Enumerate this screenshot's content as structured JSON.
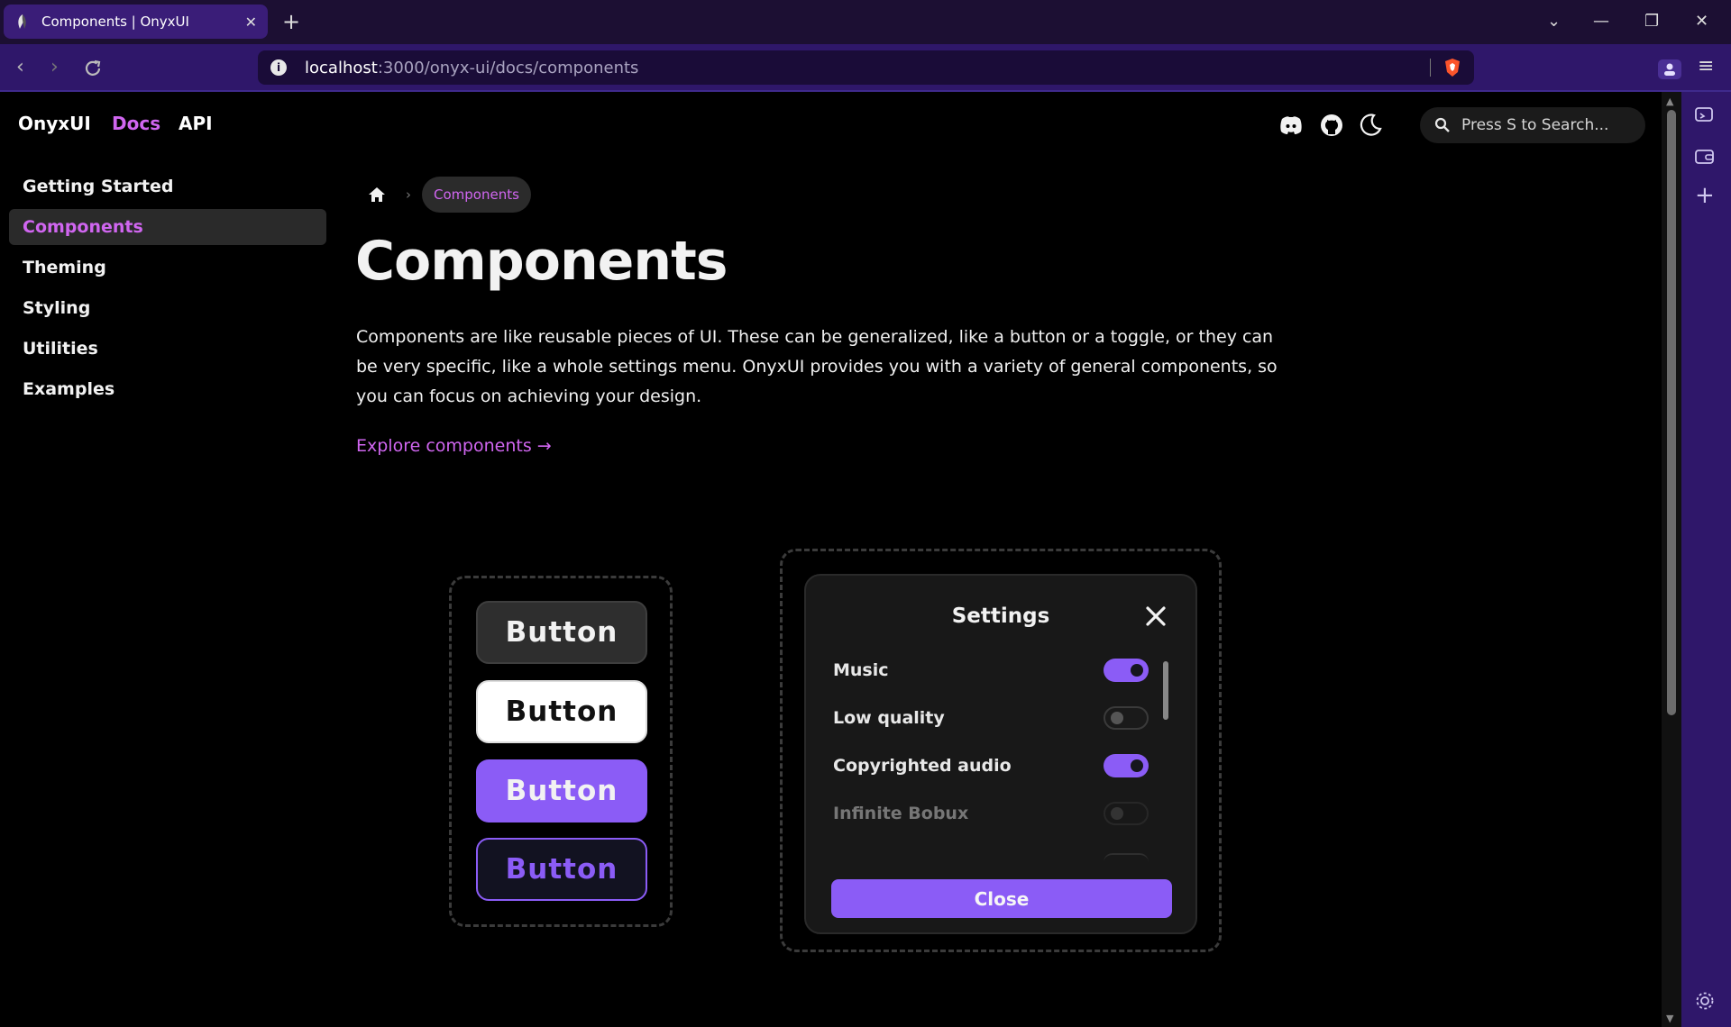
{
  "browser": {
    "tab_title": "Components | OnyxUI",
    "url_host": "localhost",
    "url_path": ":3000/onyx-ui/docs/components"
  },
  "site": {
    "brand": "OnyxUI",
    "nav": [
      {
        "label": "Docs",
        "active": true
      },
      {
        "label": "API",
        "active": false
      }
    ],
    "search_placeholder": "Press S to Search...",
    "accent_color": "#d066f0",
    "primary_color": "#8b5cf6"
  },
  "sidebar": {
    "items": [
      {
        "label": "Getting Started",
        "active": false
      },
      {
        "label": "Components",
        "active": true
      },
      {
        "label": "Theming",
        "active": false
      },
      {
        "label": "Styling",
        "active": false
      },
      {
        "label": "Utilities",
        "active": false
      },
      {
        "label": "Examples",
        "active": false
      }
    ]
  },
  "main": {
    "breadcrumb": "Components",
    "title": "Components",
    "intro": "Components are like reusable pieces of UI. These can be generalized, like a button or a toggle, or they can be very specific, like a whole settings menu. OnyxUI provides you with a variety of general components, so you can focus on achieving your design.",
    "explore_link": "Explore components →"
  },
  "showcase": {
    "buttons": [
      "Button",
      "Button",
      "Button",
      "Button"
    ],
    "settings": {
      "title": "Settings",
      "options": [
        {
          "label": "Music",
          "on": true
        },
        {
          "label": "Low quality",
          "on": false
        },
        {
          "label": "Copyrighted audio",
          "on": true
        },
        {
          "label": "Infinite Bobux",
          "on": false
        }
      ],
      "close_label": "Close"
    }
  }
}
